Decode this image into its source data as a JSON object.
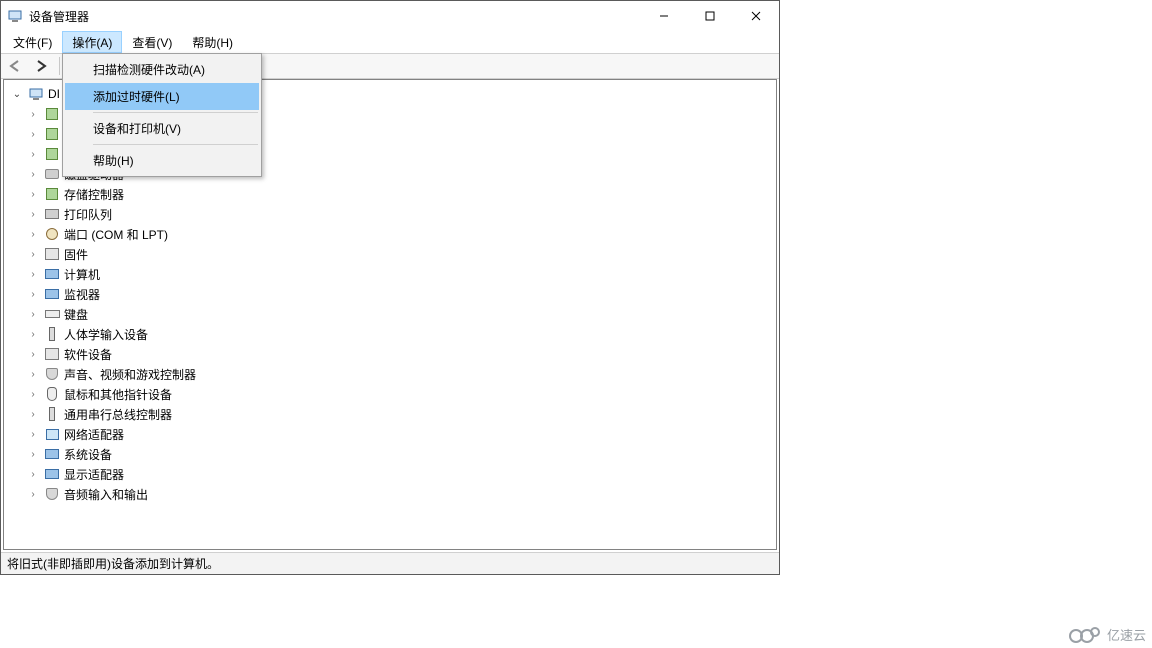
{
  "window": {
    "title": "设备管理器"
  },
  "menubar": {
    "file": "文件(F)",
    "action": "操作(A)",
    "view": "查看(V)",
    "help": "帮助(H)"
  },
  "action_menu": {
    "scan": "扫描检测硬件改动(A)",
    "add_legacy": "添加过时硬件(L)",
    "devices_printers": "设备和打印机(V)",
    "help": "帮助(H)"
  },
  "tree": {
    "root": "DI",
    "items": [
      {
        "label": "",
        "icon": "chip"
      },
      {
        "label": "",
        "icon": "chip"
      },
      {
        "label": "",
        "icon": "chip"
      },
      {
        "label": "磁盘驱动器",
        "icon": "disk"
      },
      {
        "label": "存储控制器",
        "icon": "chip"
      },
      {
        "label": "打印队列",
        "icon": "printer"
      },
      {
        "label": "端口 (COM 和 LPT)",
        "icon": "port"
      },
      {
        "label": "固件",
        "icon": "box"
      },
      {
        "label": "计算机",
        "icon": "monitor"
      },
      {
        "label": "监视器",
        "icon": "monitor"
      },
      {
        "label": "键盘",
        "icon": "kb"
      },
      {
        "label": "人体学输入设备",
        "icon": "usb"
      },
      {
        "label": "软件设备",
        "icon": "box"
      },
      {
        "label": "声音、视频和游戏控制器",
        "icon": "spk"
      },
      {
        "label": "鼠标和其他指针设备",
        "icon": "mouse"
      },
      {
        "label": "通用串行总线控制器",
        "icon": "usb"
      },
      {
        "label": "网络适配器",
        "icon": "net"
      },
      {
        "label": "系统设备",
        "icon": "monitor"
      },
      {
        "label": "显示适配器",
        "icon": "monitor"
      },
      {
        "label": "音频输入和输出",
        "icon": "spk"
      }
    ]
  },
  "statusbar": {
    "text": "将旧式(非即插即用)设备添加到计算机。"
  },
  "watermark": {
    "text": "亿速云"
  }
}
